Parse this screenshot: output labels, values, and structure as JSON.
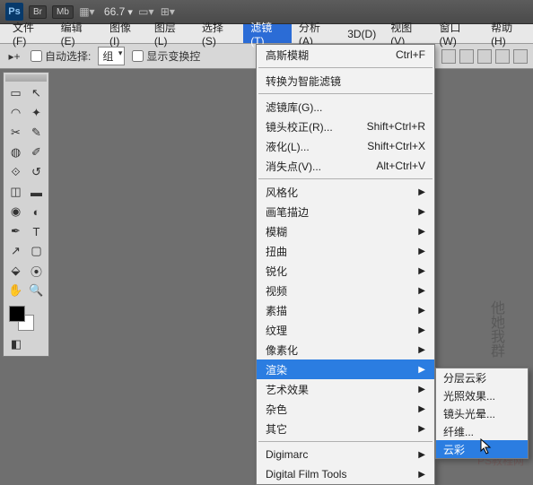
{
  "titlebar": {
    "logo": "Ps",
    "br": "Br",
    "mb": "Mb",
    "zoom": "66.7"
  },
  "menu": {
    "file": "文件(F)",
    "edit": "编辑(E)",
    "image": "图像(I)",
    "layer": "图层(L)",
    "select": "选择(S)",
    "filter": "滤镜(T)",
    "analysis": "分析(A)",
    "threeD": "3D(D)",
    "view": "视图(V)",
    "window": "窗口(W)",
    "help": "帮助(H)"
  },
  "options": {
    "auto_select": "自动选择:",
    "group": "组",
    "show_transform": "显示变换控"
  },
  "filter_menu": {
    "last": "高斯模糊",
    "last_shortcut": "Ctrl+F",
    "smart": "转换为智能滤镜",
    "gallery": "滤镜库(G)...",
    "lens": "镜头校正(R)...",
    "lens_sc": "Shift+Ctrl+R",
    "liquify": "液化(L)...",
    "liquify_sc": "Shift+Ctrl+X",
    "vanish": "消失点(V)...",
    "vanish_sc": "Alt+Ctrl+V",
    "stylize": "风格化",
    "brush": "画笔描边",
    "blur": "模糊",
    "distort": "扭曲",
    "sharpen": "锐化",
    "video": "视频",
    "sketch": "素描",
    "texture": "纹理",
    "pixelate": "像素化",
    "render": "渲染",
    "artistic": "艺术效果",
    "noise": "杂色",
    "other": "其它",
    "digimarc": "Digimarc",
    "dft": "Digital Film Tools"
  },
  "render_sub": {
    "diff_clouds": "分层云彩",
    "lighting": "光照效果...",
    "lens_flare": "镜头光晕...",
    "fibers": "纤维...",
    "clouds": "云彩"
  },
  "watermark": "他她我群",
  "wm2": "PS教程网"
}
